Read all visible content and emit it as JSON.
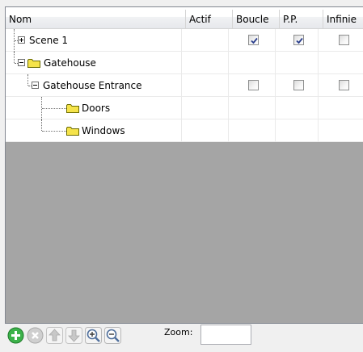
{
  "columns": [
    {
      "label": "Nom"
    },
    {
      "label": "Actif"
    },
    {
      "label": "Boucle"
    },
    {
      "label": "P.P."
    },
    {
      "label": "Infinie"
    }
  ],
  "rows": [
    {
      "label": "Scene 1",
      "type": "scene",
      "expanded": false,
      "boucle": true,
      "pp": true,
      "infinie": false
    },
    {
      "label": "Gatehouse",
      "type": "folder",
      "expanded": true
    },
    {
      "label": "Gatehouse Entrance",
      "type": "scene",
      "expanded": true,
      "boucle": false,
      "pp": false,
      "infinie": false
    },
    {
      "label": "Doors",
      "type": "folder"
    },
    {
      "label": "Windows",
      "type": "folder"
    }
  ],
  "toolbar": {
    "buttons": [
      {
        "name": "add-icon",
        "color": "#3cb24a",
        "enabled": true
      },
      {
        "name": "delete-icon",
        "color": "#c8c8c8",
        "enabled": false
      },
      {
        "name": "arrow-up-icon",
        "color": "#c8c8c8",
        "enabled": false
      },
      {
        "name": "arrow-down-icon",
        "color": "#c8c8c8",
        "enabled": false
      },
      {
        "name": "zoom-in-icon",
        "color": "#7aa2d6",
        "enabled": true
      },
      {
        "name": "zoom-out-icon",
        "color": "#7aa2d6",
        "enabled": true
      }
    ],
    "zoom_label": "Zoom:",
    "zoom_value": "",
    "zoom_placeholder": ""
  },
  "colors": {
    "folder": "#f5e34a",
    "checkmark": "#2a3e8c",
    "empty_area": "#a5a5a5"
  }
}
